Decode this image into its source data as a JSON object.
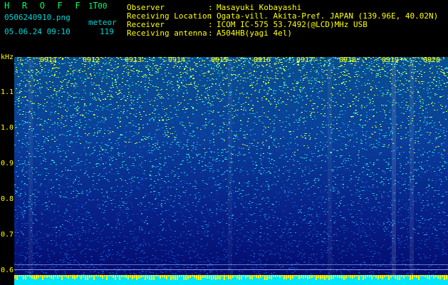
{
  "app": {
    "name": "H R O F F T",
    "version": "1.00"
  },
  "file": {
    "name": "0506240910.png",
    "datetime": "05.06.24 09:10"
  },
  "meteor": {
    "label": "meteor",
    "count": "119"
  },
  "info": [
    {
      "key": "Observer",
      "value": "Masayuki Kobayashi"
    },
    {
      "key": "Receiving Location",
      "value": "Ogata-vill. Akita-Pref. JAPAN (139.96E, 40.02N)"
    },
    {
      "key": "Receiver",
      "value": "ICOM IC-575 53.7492(@LCD)MHz USB"
    },
    {
      "key": "Receiving antenna",
      "value": "A504HB(yagi 4el)"
    }
  ],
  "axis": {
    "unit": "kHz",
    "y_ticks": [
      "1.1",
      "1.0",
      "0.9",
      "0.8",
      "0.7",
      "0.6"
    ],
    "x_ticks": [
      "0911",
      "0912",
      "0913",
      "0914",
      "0915",
      "0916",
      "0917",
      "0918",
      "0919",
      "0920"
    ]
  },
  "colors": {
    "label_yellow": "#ffff00",
    "header_green": "#00ff66",
    "header_cyan": "#00d6d6",
    "spectrogram_low": "#00006e",
    "spectrogram_high": "#00e0e0"
  }
}
